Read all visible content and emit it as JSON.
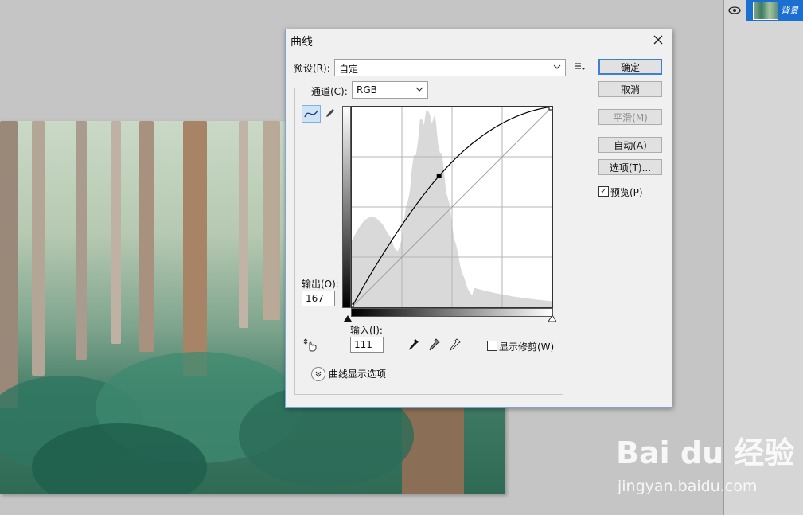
{
  "dialog": {
    "title": "曲线",
    "preset_label": "预设(R):",
    "preset_value": "自定",
    "channel_label": "通道(C):",
    "channel_value": "RGB",
    "output_label": "输出(O):",
    "output_value": "167",
    "input_label": "输入(I):",
    "input_value": "111",
    "show_clipping_label": "显示修剪(W)",
    "curve_display_options_label": "曲线显示选项",
    "buttons": {
      "ok": "确定",
      "cancel": "取消",
      "smooth": "平滑(M)",
      "auto": "自动(A)",
      "options": "选项(T)..."
    },
    "preview_label": "预览(P)",
    "preview_checked": true,
    "show_clipping_checked": false
  },
  "curve": {
    "points": [
      [
        0,
        0
      ],
      [
        111,
        167
      ],
      [
        255,
        255
      ]
    ],
    "selected_point": [
      111,
      167
    ]
  },
  "layers": {
    "active_layer_name": "背景"
  },
  "watermark": {
    "logo": "Bai du 经验",
    "url": "jingyan.baidu.com"
  },
  "colors": {
    "accent": "#1b6fd1",
    "dialog_bg": "#f0f0f0",
    "histogram": "#d9d9d9"
  }
}
